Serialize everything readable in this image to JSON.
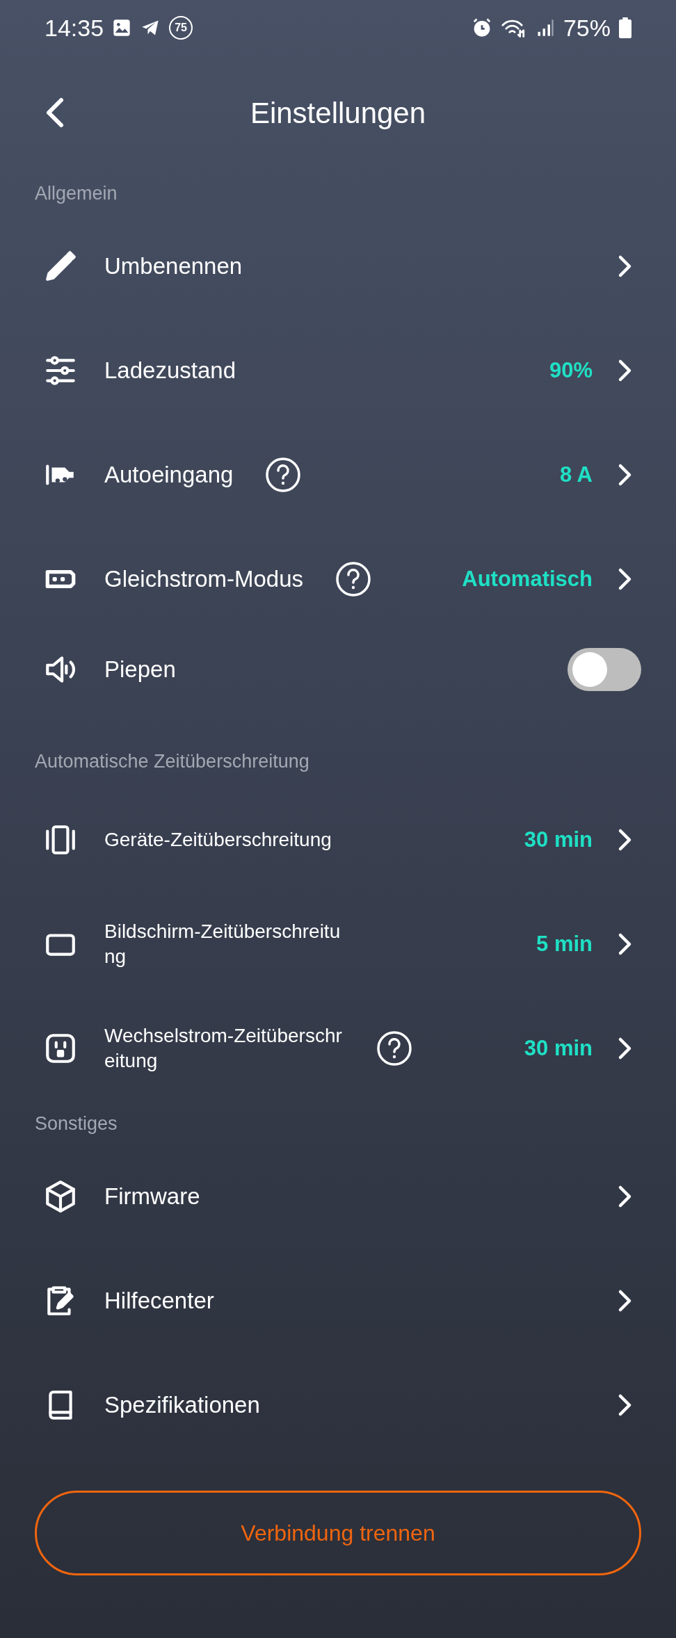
{
  "status_bar": {
    "time": "14:35",
    "badge": "75",
    "battery": "75%"
  },
  "header": {
    "title": "Einstellungen"
  },
  "sections": [
    {
      "title": "Allgemein",
      "rows": [
        {
          "kind": "link",
          "label": "Umbenennen",
          "help": false
        },
        {
          "kind": "link",
          "label": "Ladezustand",
          "value": "90%",
          "help": false
        },
        {
          "kind": "link",
          "label": "Autoeingang",
          "value": "8 A",
          "help": true
        },
        {
          "kind": "link",
          "label": "Gleichstrom-Modus",
          "value": "Automatisch",
          "help": true
        },
        {
          "kind": "toggle",
          "label": "Piepen",
          "on": false
        }
      ]
    },
    {
      "title": "Automatische Zeitüberschreitung",
      "rows": [
        {
          "kind": "link",
          "label": "Geräte-Zeitüberschreitung",
          "value": "30 min",
          "help": false
        },
        {
          "kind": "link",
          "label": "Bildschirm-Zeitüberschreitung",
          "value": "5 min",
          "help": false
        },
        {
          "kind": "link",
          "label": "Wechselstrom-Zeitüberschreitung",
          "value": "30 min",
          "help": true
        }
      ]
    },
    {
      "title": "Sonstiges",
      "rows": [
        {
          "kind": "link",
          "label": "Firmware",
          "help": false
        },
        {
          "kind": "link",
          "label": "Hilfecenter",
          "help": false
        },
        {
          "kind": "link",
          "label": "Spezifikationen",
          "help": false
        }
      ]
    }
  ],
  "disconnect_button": {
    "label": "Verbindung trennen"
  }
}
